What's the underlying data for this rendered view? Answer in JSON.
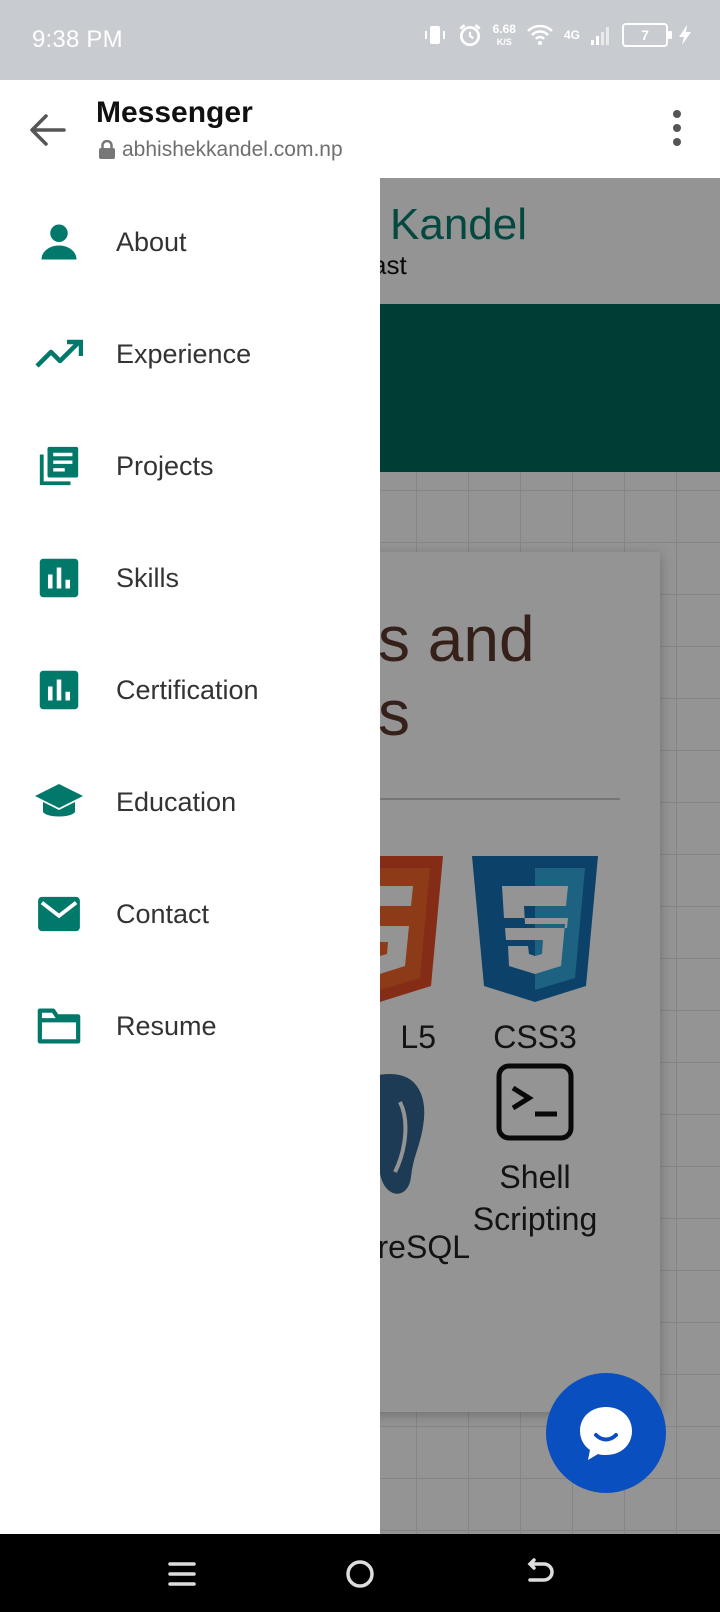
{
  "status_bar": {
    "time": "9:38 PM",
    "net_speed_value": "6.68",
    "net_speed_unit": "K/S",
    "network_type": "4G",
    "battery_level": "7"
  },
  "header": {
    "title": "Messenger",
    "url": "abhishekkandel.com.np"
  },
  "site": {
    "name_partial": "Kandel",
    "subtitle_partial": "ast",
    "section_title_line1": "s and",
    "section_title_line2": "s",
    "skills": [
      {
        "label": "L5"
      },
      {
        "label": "CSS3"
      },
      {
        "label": "reSQL"
      },
      {
        "label": "Shell Scripting"
      }
    ]
  },
  "drawer": {
    "items": [
      {
        "label": "About",
        "icon": "person-icon"
      },
      {
        "label": "Experience",
        "icon": "trending-up-icon"
      },
      {
        "label": "Projects",
        "icon": "library-books-icon"
      },
      {
        "label": "Skills",
        "icon": "bar-chart-icon"
      },
      {
        "label": "Certification",
        "icon": "bar-chart-icon"
      },
      {
        "label": "Education",
        "icon": "school-icon"
      },
      {
        "label": "Contact",
        "icon": "mail-icon"
      },
      {
        "label": "Resume",
        "icon": "folder-icon"
      }
    ]
  },
  "colors": {
    "accent": "#00796b",
    "site_band": "#00695c",
    "chat_button": "#0a4fbf"
  }
}
